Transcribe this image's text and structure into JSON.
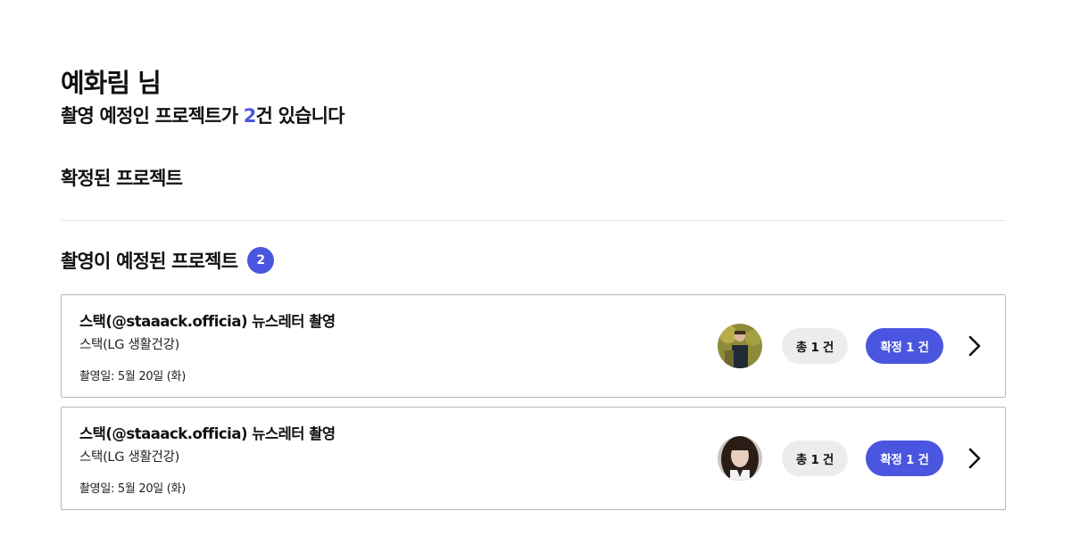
{
  "header": {
    "name_label": "예화림 님",
    "subtitle_prefix": "촬영 예정인 프로젝트가 ",
    "subtitle_count": "2",
    "subtitle_suffix": "건 있습니다"
  },
  "confirmed_section": {
    "title": "확정된 프로젝트"
  },
  "scheduled_section": {
    "title": "촬영이 예정된 프로젝트",
    "count": "2"
  },
  "projects": [
    {
      "title": "스택(@staaack.officia) 뉴스레터 촬영",
      "client": "스택(LG 생활건강)",
      "shoot_date": "촬영일: 5월 20일 (화)",
      "total_label": "총 1 건",
      "confirmed_label": "확정 1 건"
    },
    {
      "title": "스택(@staaack.officia) 뉴스레터 촬영",
      "client": "스택(LG 생활건강)",
      "shoot_date": "촬영일: 5월 20일 (화)",
      "total_label": "총 1 건",
      "confirmed_label": "확정 1 건"
    }
  ],
  "icons": {
    "row_arrow": "chevron-right-icon"
  },
  "colors": {
    "accent": "#4a55e0",
    "pill_grey": "#ececec",
    "card_border": "#b8b8b8"
  }
}
